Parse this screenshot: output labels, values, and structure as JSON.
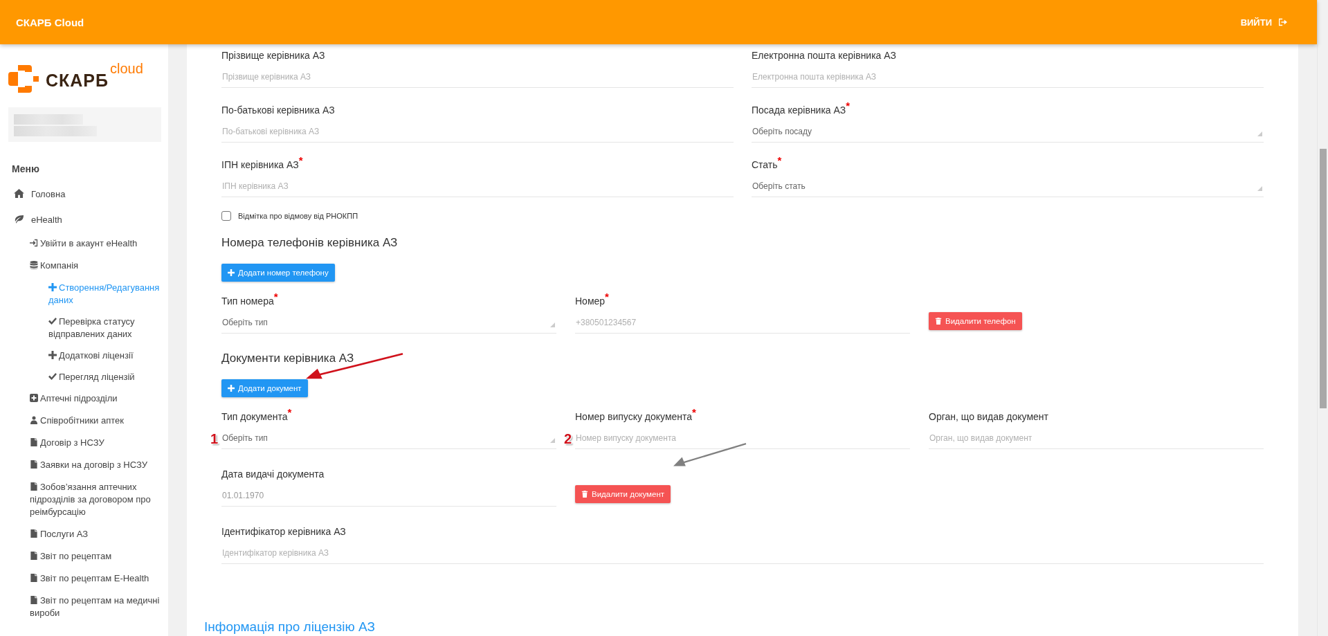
{
  "header": {
    "title": "СКАРБ Cloud",
    "logout": "ВИЙТИ"
  },
  "sidebar": {
    "logo": {
      "brand": "СКАРБ",
      "suffix": "cloud"
    },
    "menu_title": "Меню",
    "items": [
      {
        "label": "Головна",
        "kind": "home",
        "selected": false
      },
      {
        "label": "eHealth",
        "kind": "leaf",
        "selected": false,
        "children": [
          {
            "label": "Увійти в акаунт eHealth",
            "kind": "login",
            "selected": false
          },
          {
            "label": "Компанія",
            "kind": "database",
            "selected": false,
            "children": [
              {
                "label": "Створення/Редагування даних",
                "kind": "plus",
                "selected": true
              },
              {
                "label": "Перевірка статусу відправлених даних",
                "kind": "check",
                "selected": false
              },
              {
                "label": "Додаткові ліцензії",
                "kind": "plus",
                "selected": false
              },
              {
                "label": "Перегляд ліцензій",
                "kind": "check",
                "selected": false
              }
            ]
          },
          {
            "label": "Аптечні підрозділи",
            "kind": "plus-square",
            "selected": false
          },
          {
            "label": "Співробітники аптек",
            "kind": "users",
            "selected": false
          },
          {
            "label": "Договір з НСЗУ",
            "kind": "file",
            "selected": false
          },
          {
            "label": "Заявки на договір з НСЗУ",
            "kind": "file",
            "selected": false
          },
          {
            "label": "Зобов’язання аптечних підрозділів за договором про реімбурсацію",
            "kind": "file",
            "selected": false
          },
          {
            "label": "Послуги АЗ",
            "kind": "file",
            "selected": false
          },
          {
            "label": "Звіт по рецептам",
            "kind": "file",
            "selected": false
          },
          {
            "label": "Звіт по рецептам E-Health",
            "kind": "file",
            "selected": false
          },
          {
            "label": "Звіт по рецептам на медичні вироби",
            "kind": "file",
            "selected": false
          }
        ]
      }
    ]
  },
  "person_fields": [
    {
      "label": "Прізвище керівника АЗ",
      "kind": "input",
      "placeholder": "Прізвище керівника АЗ"
    },
    {
      "label": "Електронна пошта керівника АЗ",
      "kind": "input",
      "placeholder": "Електронна пошта керівника АЗ"
    },
    {
      "label": "По-батькові керівника АЗ",
      "kind": "input",
      "placeholder": "По-батькові керівника АЗ"
    },
    {
      "label": "Посада керівника АЗ$^{*}$",
      "kind": "select",
      "value": "Оберіть посаду"
    },
    {
      "label": "ІПН керівника АЗ$^{*}$",
      "kind": "input",
      "placeholder": "ІПН керівника АЗ"
    },
    {
      "label": "Стать$^{*}$",
      "kind": "select",
      "value": "Оберіть стать"
    }
  ],
  "refusal_checkbox": {
    "label": "Відмітка про відмову від РНОКПП",
    "checked": false
  },
  "phones": {
    "title": "Номера телефонів керівника АЗ",
    "add_button": "Додати номер телефону",
    "fields": [
      {
        "label": "Тип номера$^{*}$",
        "kind": "select",
        "value": "Оберіть тип"
      },
      {
        "label": "Номер$^{*}$",
        "kind": "input",
        "placeholder": "+380501234567"
      }
    ],
    "delete_button": "Видалити телефон"
  },
  "annotation_arrows": [
    {
      "color": "#d0111b"
    },
    {
      "color": "#808080"
    }
  ],
  "documents": {
    "title": "Документи керівника АЗ",
    "add_button": "Додати документ",
    "fields": [
      {
        "label": "Тип документа$^{*}$",
        "kind": "select",
        "value": "Оберіть тип",
        "marker": "1"
      },
      {
        "label": "Номер випуску документа$^{*}$",
        "kind": "input",
        "placeholder": "Номер випуску документа",
        "marker": "2"
      },
      {
        "label": "Орган, що видав документ",
        "kind": "input",
        "placeholder": "Орган, що видав документ"
      },
      {
        "label": "Дата видачі документа",
        "kind": "date",
        "placeholder": "01.01.1970"
      }
    ],
    "delete_button": "Видалити документ",
    "identifier": {
      "label": "Ідентифікатор керівника АЗ",
      "kind": "input",
      "placeholder": "Ідентифікатор керівника АЗ"
    }
  },
  "license_title": "Інформація про ліцензію АЗ"
}
